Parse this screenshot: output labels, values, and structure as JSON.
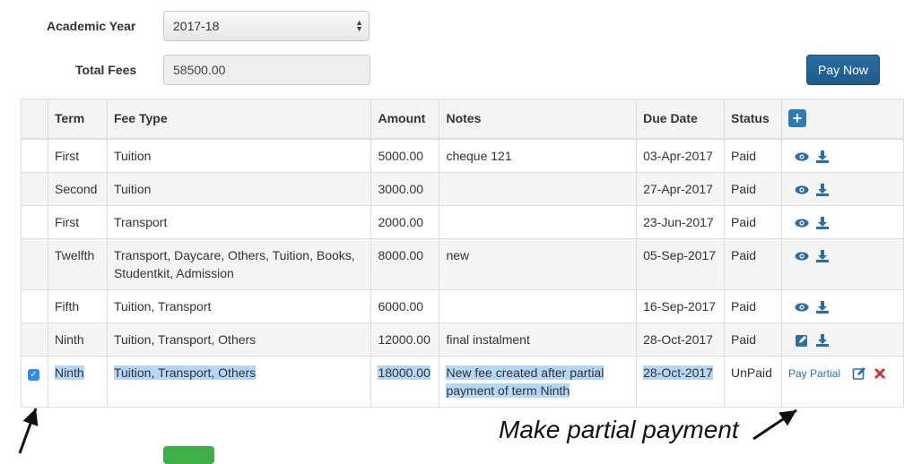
{
  "form": {
    "year_label": "Academic Year",
    "year_value": "2017-18",
    "fees_label": "Total Fees",
    "fees_value": "58500.00",
    "pay_now_label": "Pay Now"
  },
  "table": {
    "headers": [
      "",
      "Term",
      "Fee Type",
      "Amount",
      "Notes",
      "Due Date",
      "Status",
      ""
    ],
    "rows": [
      {
        "term": "First",
        "fee_type": "Tuition",
        "amount": "5000.00",
        "notes": "cheque 121",
        "due": "03-Apr-2017",
        "status": "Paid"
      },
      {
        "term": "Second",
        "fee_type": "Tuition",
        "amount": "3000.00",
        "notes": "",
        "due": "27-Apr-2017",
        "status": "Paid"
      },
      {
        "term": "First",
        "fee_type": "Transport",
        "amount": "2000.00",
        "notes": "",
        "due": "23-Jun-2017",
        "status": "Paid"
      },
      {
        "term": "Twelfth",
        "fee_type": "Transport, Daycare, Others, Tuition, Books, Studentkit, Admission",
        "amount": "8000.00",
        "notes": "new",
        "due": "05-Sep-2017",
        "status": "Paid"
      },
      {
        "term": "Fifth",
        "fee_type": "Tuition, Transport",
        "amount": "6000.00",
        "notes": "",
        "due": "16-Sep-2017",
        "status": "Paid"
      },
      {
        "term": "Ninth",
        "fee_type": "Tuition, Transport, Others",
        "amount": "12000.00",
        "notes": "final instalment",
        "due": "28-Oct-2017",
        "status": "Paid"
      },
      {
        "term": "Ninth",
        "fee_type": "Tuition, Transport, Others",
        "amount": "18000.00",
        "notes": "New fee created after partial payment of term Ninth",
        "due": "28-Oct-2017",
        "status": "UnPaid",
        "action_label": "Pay Partial"
      }
    ]
  },
  "annotation": "Make partial payment",
  "colors": {
    "accent": "#2b6ea3",
    "selection": "#b4d6f7"
  }
}
